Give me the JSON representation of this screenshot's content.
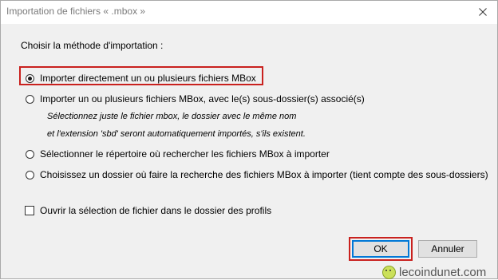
{
  "window": {
    "title": "Importation de fichiers « .mbox »",
    "close_icon": "close-icon"
  },
  "dialog": {
    "heading": "Choisir la méthode d'importation :",
    "options": [
      {
        "label": "Importer directement un ou plusieurs fichiers MBox",
        "selected": true
      },
      {
        "label": "Importer un ou plusieurs fichiers MBox, avec le(s) sous-dossier(s) associé(s)",
        "selected": false
      },
      {
        "label": "Sélectionner le répertoire où rechercher les fichiers MBox à importer",
        "selected": false
      },
      {
        "label": "Choisissez un dossier où faire la recherche des fichiers MBox à importer (tient compte des sous-dossiers)",
        "selected": false
      }
    ],
    "hint_line1": "Sélectionnez juste le fichier mbox, le dossier avec le même nom",
    "hint_line2": "et l'extension 'sbd' seront automatiquement importés, s'ils existent.",
    "checkbox_label": "Ouvrir la sélection de fichier dans le dossier des profils",
    "checkbox_checked": false
  },
  "buttons": {
    "ok": "OK",
    "cancel": "Annuler"
  },
  "highlight_color": "#c9211e",
  "watermark": "lecoindunet.com"
}
